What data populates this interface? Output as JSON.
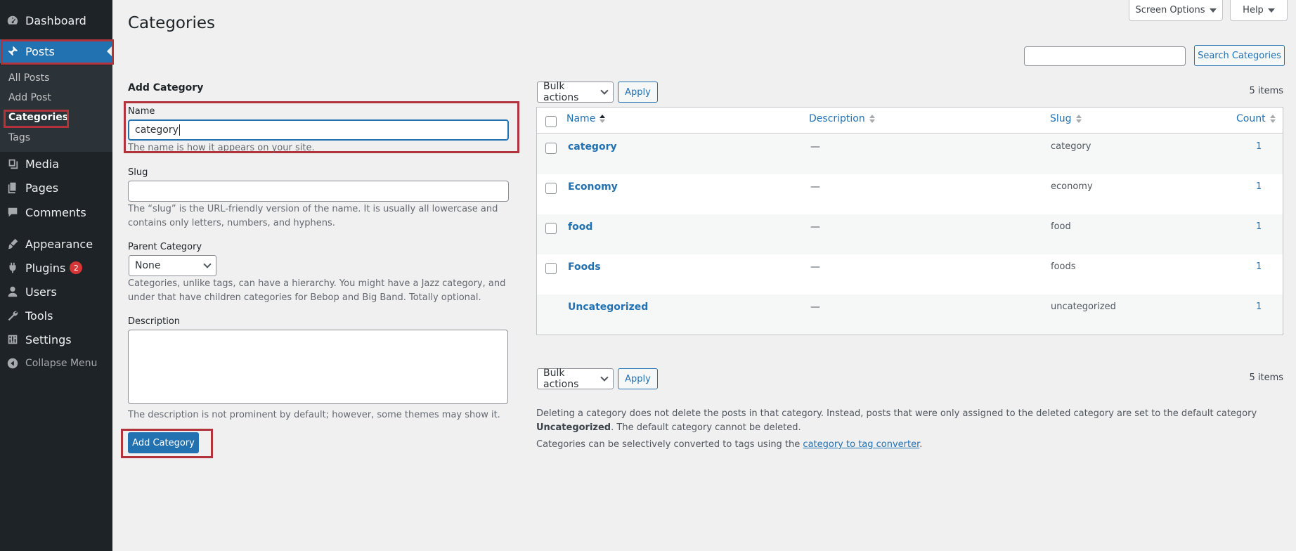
{
  "sidebar": {
    "items": [
      {
        "label": "Dashboard",
        "icon": "dashboard-icon"
      },
      {
        "label": "Posts",
        "icon": "pin-icon"
      },
      {
        "label": "Media",
        "icon": "media-icon"
      },
      {
        "label": "Pages",
        "icon": "pages-icon"
      },
      {
        "label": "Comments",
        "icon": "comments-icon"
      },
      {
        "label": "Appearance",
        "icon": "brush-icon"
      },
      {
        "label": "Plugins",
        "icon": "plugin-icon",
        "badge": "2"
      },
      {
        "label": "Users",
        "icon": "users-icon"
      },
      {
        "label": "Tools",
        "icon": "wrench-icon"
      },
      {
        "label": "Settings",
        "icon": "settings-icon"
      },
      {
        "label": "Collapse Menu",
        "icon": "collapse-icon"
      }
    ],
    "submenu": [
      "All Posts",
      "Add Post",
      "Categories",
      "Tags"
    ]
  },
  "header": {
    "title": "Categories",
    "screen_options": "Screen Options",
    "help": "Help",
    "search_button": "Search Categories",
    "search_value": ""
  },
  "form": {
    "heading": "Add Category",
    "name_label": "Name",
    "name_value": "category",
    "name_hint": "The name is how it appears on your site.",
    "slug_label": "Slug",
    "slug_value": "",
    "slug_hint": "The “slug” is the URL-friendly version of the name. It is usually all lowercase and contains only letters, numbers, and hyphens.",
    "parent_label": "Parent Category",
    "parent_value": "None",
    "parent_hint": "Categories, unlike tags, can have a hierarchy. You might have a Jazz category, and under that have children categories for Bebop and Big Band. Totally optional.",
    "description_label": "Description",
    "description_hint": "The description is not prominent by default; however, some themes may show it.",
    "submit": "Add Category"
  },
  "list": {
    "bulk_actions": "Bulk actions",
    "apply": "Apply",
    "items_count": "5 items",
    "columns": {
      "name": "Name",
      "description": "Description",
      "slug": "Slug",
      "count": "Count"
    },
    "rows": [
      {
        "name": "category",
        "description": "—",
        "slug": "category",
        "count": "1"
      },
      {
        "name": "Economy",
        "description": "—",
        "slug": "economy",
        "count": "1"
      },
      {
        "name": "food",
        "description": "—",
        "slug": "food",
        "count": "1"
      },
      {
        "name": "Foods",
        "description": "—",
        "slug": "foods",
        "count": "1"
      },
      {
        "name": "Uncategorized",
        "description": "—",
        "slug": "uncategorized",
        "count": "1"
      }
    ]
  },
  "notes": {
    "line1_pre": "Deleting a category does not delete the posts in that category. Instead, posts that were only assigned to the deleted category are set to the default category ",
    "line1_bold": "Uncategorized",
    "line1_post": ". The default category cannot be deleted.",
    "line2_pre": "Categories can be selectively converted to tags using the ",
    "line2_link": "category to tag converter",
    "line2_post": "."
  },
  "colors": {
    "accent": "#2271b1",
    "sidebar": "#1d2327",
    "highlight": "#b3333d",
    "badge": "#d63638"
  }
}
